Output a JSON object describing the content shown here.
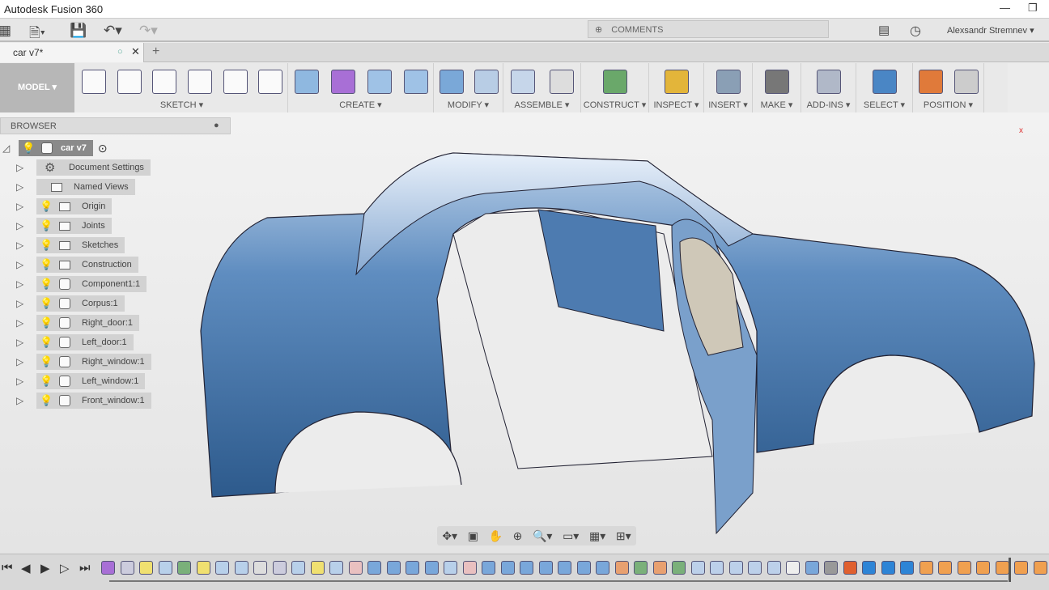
{
  "app_title": "Autodesk Fusion 360",
  "window_controls": {
    "minimize": "—",
    "restore": "❐"
  },
  "quick_access": {
    "grid": "▦",
    "file": "🗎▾",
    "save": "💾",
    "undo": "↶▾",
    "redo": "↷▾"
  },
  "comments": {
    "icon": "⊕",
    "label": "COMMENTS"
  },
  "user": {
    "name": "Alexsandr Stremnev ▾",
    "chat_icon": "▤",
    "history_icon": "◷"
  },
  "document_tab": {
    "label": "car v7*",
    "new_tab": "+"
  },
  "toolbar": {
    "workspace": "MODEL ▾",
    "groups": [
      {
        "label": "SKETCH ▾",
        "icons": [
          "spline",
          "plane-sketch",
          "dimension",
          "circle",
          "create-sketch",
          "rectangle"
        ]
      },
      {
        "label": "CREATE ▾",
        "icons": [
          "box",
          "form",
          "extrude",
          "revolve"
        ]
      },
      {
        "label": "MODIFY ▾",
        "icons": [
          "press-pull",
          "fillet"
        ]
      },
      {
        "label": "ASSEMBLE ▾",
        "icons": [
          "new-component",
          "joint"
        ]
      },
      {
        "label": "CONSTRUCT ▾",
        "icons": [
          "offset-plane"
        ]
      },
      {
        "label": "INSPECT ▾",
        "icons": [
          "measure"
        ]
      },
      {
        "label": "INSERT ▾",
        "icons": [
          "insert-image"
        ]
      },
      {
        "label": "MAKE ▾",
        "icons": [
          "3d-print"
        ]
      },
      {
        "label": "ADD-INS ▾",
        "icons": [
          "scripts"
        ]
      },
      {
        "label": "SELECT ▾",
        "icons": [
          "select"
        ]
      },
      {
        "label": "POSITION ▾",
        "icons": [
          "capture-position",
          "revert"
        ]
      }
    ]
  },
  "browser": {
    "title": "BROWSER",
    "root": "car v7",
    "items": [
      {
        "label": "Document Settings",
        "type": "settings",
        "bulb": false
      },
      {
        "label": "Named Views",
        "type": "folder",
        "bulb": false
      },
      {
        "label": "Origin",
        "type": "folder",
        "bulb": true
      },
      {
        "label": "Joints",
        "type": "folder",
        "bulb": true
      },
      {
        "label": "Sketches",
        "type": "folder",
        "bulb": true
      },
      {
        "label": "Construction",
        "type": "folder",
        "bulb": true
      },
      {
        "label": "Component1:1",
        "type": "component",
        "bulb": true,
        "bulb_off": true
      },
      {
        "label": "Corpus:1",
        "type": "component",
        "bulb": true
      },
      {
        "label": "Right_door:1",
        "type": "component",
        "bulb": true
      },
      {
        "label": "Left_door:1",
        "type": "component",
        "bulb": true
      },
      {
        "label": "Right_window:1",
        "type": "component",
        "bulb": true
      },
      {
        "label": "Left_window:1",
        "type": "component",
        "bulb": true
      },
      {
        "label": "Front_window:1",
        "type": "component",
        "bulb": true
      }
    ]
  },
  "navbar": [
    "✥▾",
    "▣",
    "✋",
    "⊕",
    "🔍▾",
    "▭▾",
    "▦▾",
    "⊞▾"
  ],
  "playback": [
    "⏮",
    "◀",
    "▶",
    "▷",
    "⏭"
  ],
  "timeline_features": [
    "form",
    "plane",
    "sketch",
    "extrude",
    "plane2",
    "sketch",
    "extrude",
    "extrude",
    "joint",
    "fillet",
    "extrude",
    "sketch",
    "extrude",
    "surface",
    "box",
    "box",
    "box",
    "box",
    "extrude",
    "surface",
    "box",
    "box",
    "box",
    "box",
    "box",
    "box",
    "box",
    "fillet2",
    "plane2",
    "fillet2",
    "plane2",
    "plane3",
    "plane3",
    "plane3",
    "plane3",
    "plane3",
    "shell",
    "box",
    "pattern",
    "pin",
    "move",
    "move",
    "move",
    "pos",
    "pos",
    "pos",
    "pos",
    "pos",
    "pos",
    "pos",
    "pos"
  ],
  "colors": {
    "accent": "#3a7cc1",
    "car_body": "#3f6fa3",
    "select_active": "#4a86c5"
  }
}
